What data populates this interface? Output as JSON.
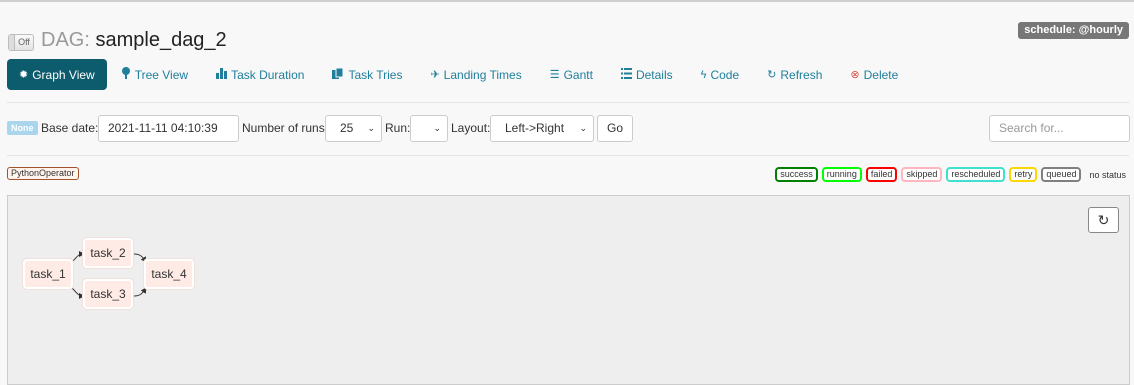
{
  "header": {
    "toggle_label": "Off",
    "title_prefix": "DAG:",
    "dag_id": "sample_dag_2",
    "schedule_label": "schedule: @hourly"
  },
  "nav": {
    "items": [
      {
        "label": "Graph View",
        "icon": "asterisk-icon",
        "active": true
      },
      {
        "label": "Tree View",
        "icon": "tree-icon"
      },
      {
        "label": "Task Duration",
        "icon": "bar-chart-icon"
      },
      {
        "label": "Task Tries",
        "icon": "duplicate-icon"
      },
      {
        "label": "Landing Times",
        "icon": "plane-icon"
      },
      {
        "label": "Gantt",
        "icon": "align-left-icon"
      },
      {
        "label": "Details",
        "icon": "list-icon"
      },
      {
        "label": "Code",
        "icon": "flash-icon"
      },
      {
        "label": "Refresh",
        "icon": "refresh-icon"
      },
      {
        "label": "Delete",
        "icon": "remove-circle-icon"
      }
    ]
  },
  "controls": {
    "state_badge": "None",
    "base_date_label": "Base date:",
    "base_date_value": "2021-11-11 04:10:39",
    "num_runs_label": "Number of runs:",
    "num_runs_value": "25",
    "run_label": "Run:",
    "run_value": "",
    "layout_label": "Layout:",
    "layout_value": "Left->Right",
    "go_label": "Go",
    "search_placeholder": "Search for..."
  },
  "operators": [
    "PythonOperator"
  ],
  "legend": {
    "states": [
      {
        "label": "success",
        "color": "#008000"
      },
      {
        "label": "running",
        "color": "#00ff00"
      },
      {
        "label": "failed",
        "color": "#ff0000"
      },
      {
        "label": "skipped",
        "color": "#ffb6c1"
      },
      {
        "label": "rescheduled",
        "color": "#40e0d0"
      },
      {
        "label": "retry",
        "color": "#ffd700"
      },
      {
        "label": "queued",
        "color": "#808080"
      }
    ],
    "no_status_label": "no status"
  },
  "graph": {
    "refresh_icon": "refresh-icon",
    "tasks": [
      {
        "id": "task_1"
      },
      {
        "id": "task_2"
      },
      {
        "id": "task_3"
      },
      {
        "id": "task_4"
      }
    ],
    "edges": [
      [
        "task_1",
        "task_2"
      ],
      [
        "task_1",
        "task_3"
      ],
      [
        "task_2",
        "task_4"
      ],
      [
        "task_3",
        "task_4"
      ]
    ]
  },
  "colors": {
    "nav_active_bg": "#0d5c6e",
    "nav_link": "#1f7f9c",
    "task_node_fill": "#ffebe5",
    "schedule_bg": "#777777"
  }
}
